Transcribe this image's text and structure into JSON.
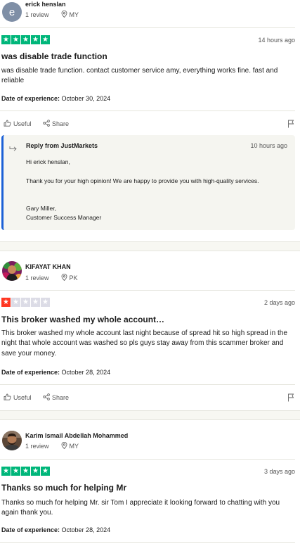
{
  "reviews": [
    {
      "avatar_letter": "e",
      "author": "erick henslan",
      "review_count": "1 review",
      "country": "MY",
      "rating": 5,
      "date": "14 hours ago",
      "title": "was disable trade function",
      "body": "was disable trade function. contact customer service amy, everything works fine. fast and reliable",
      "experience_label": "Date of experience:",
      "experience_date": "October 30, 2024",
      "useful_label": "Useful",
      "share_label": "Share",
      "reply": {
        "from": "Reply from JustMarkets",
        "date": "10 hours ago",
        "greeting": "Hi erick henslan,",
        "message": "Thank you for your high opinion! We are happy to provide you with high-quality services.",
        "sign_name": "Gary Miller,",
        "sign_title": "Customer Success Manager"
      }
    },
    {
      "author": "KIFAYAT KHAN",
      "review_count": "1 review",
      "country": "PK",
      "rating": 1,
      "date": "2 days ago",
      "title": "This broker washed my whole account…",
      "body": "This broker washed my whole account last night because of spread hit so high spread in the night that whole account was washed so pls guys stay away from this scammer broker and save your money.",
      "experience_label": "Date of experience:",
      "experience_date": "October 28, 2024",
      "useful_label": "Useful",
      "share_label": "Share"
    },
    {
      "author": "Karim Ismail Abdellah Mohammed",
      "review_count": "1 review",
      "country": "MY",
      "rating": 5,
      "date": "3 days ago",
      "title": "Thanks so much for helping Mr",
      "body": "Thanks so much for helping Mr. sir Tom I appreciate it looking forward to chatting with you again thank you.",
      "experience_label": "Date of experience:",
      "experience_date": "October 28, 2024"
    }
  ],
  "colors": {
    "star_green": "#00b67a",
    "star_red": "#ff3722",
    "star_empty": "#dcdce6",
    "reply_accent": "#1b60d6"
  }
}
